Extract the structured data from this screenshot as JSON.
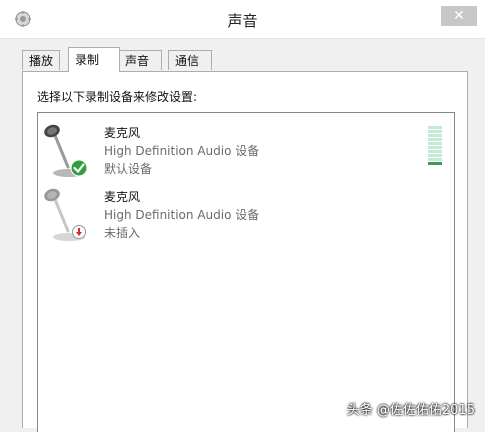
{
  "window": {
    "title": "声音",
    "close_label": "✕"
  },
  "tabs": [
    {
      "label": "播放",
      "active": false
    },
    {
      "label": "录制",
      "active": true
    },
    {
      "label": "声音",
      "active": false
    },
    {
      "label": "通信",
      "active": false
    }
  ],
  "panel": {
    "instruction": "选择以下录制设备来修改设置:"
  },
  "devices": [
    {
      "name": "麦克风",
      "description": "High Definition Audio 设备",
      "status": "默认设备",
      "badge": "check-icon",
      "level": 0.1
    },
    {
      "name": "麦克风",
      "description": "High Definition Audio 设备",
      "status": "未插入",
      "badge": "unplugged-icon"
    }
  ],
  "watermark": "头条 @佐佐佑佑2015",
  "colors": {
    "meter_on": "#3a9a55",
    "meter_off": "#c5e9d4",
    "check": "#2e9e3e",
    "unplugged": "#d12b2b"
  }
}
